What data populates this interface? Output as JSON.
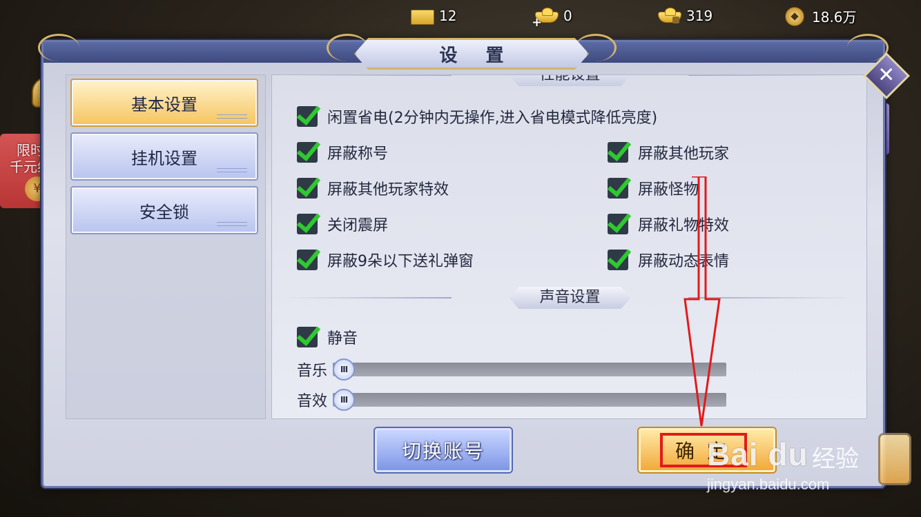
{
  "currency": {
    "ticket": "12",
    "ingot_bound": "0",
    "ingot_locked": "319",
    "coin": "18.6万"
  },
  "dialog": {
    "title": "设 置",
    "close_symbol": "✕"
  },
  "menu": {
    "items": [
      {
        "label": "基本设置",
        "active": true
      },
      {
        "label": "挂机设置",
        "active": false
      },
      {
        "label": "安全锁",
        "active": false
      }
    ]
  },
  "performance": {
    "header": "性能设置",
    "options": [
      {
        "label": "闲置省电(2分钟内无操作,进入省电模式降低亮度)",
        "checked": true
      },
      {
        "label": "屏蔽称号",
        "checked": true
      },
      {
        "label": "屏蔽其他玩家",
        "checked": true
      },
      {
        "label": "屏蔽其他玩家特效",
        "checked": true
      },
      {
        "label": "屏蔽怪物",
        "checked": true
      },
      {
        "label": "关闭震屏",
        "checked": true
      },
      {
        "label": "屏蔽礼物特效",
        "checked": true
      },
      {
        "label": "屏蔽9朵以下送礼弹窗",
        "checked": true
      },
      {
        "label": "屏蔽动态表情",
        "checked": true
      }
    ]
  },
  "sound": {
    "header": "声音设置",
    "mute": {
      "label": "静音",
      "checked": true
    },
    "music": {
      "label": "音乐",
      "level": 0.0,
      "knob": "III"
    },
    "effects": {
      "label": "音效",
      "level": 0.0,
      "knob": "III"
    }
  },
  "buttons": {
    "switch_account": "切换账号",
    "confirm": "确定"
  },
  "promo": {
    "line1": "限时领",
    "line2": "千元红包",
    "coin": "¥"
  },
  "watermark": {
    "logo": "Bai du",
    "cn": "经验",
    "url": "jingyan.baidu.com"
  },
  "colors": {
    "check_green": "#2ec92f",
    "annotation_red": "#e21a1a",
    "active_tab": "#f6c45e"
  }
}
